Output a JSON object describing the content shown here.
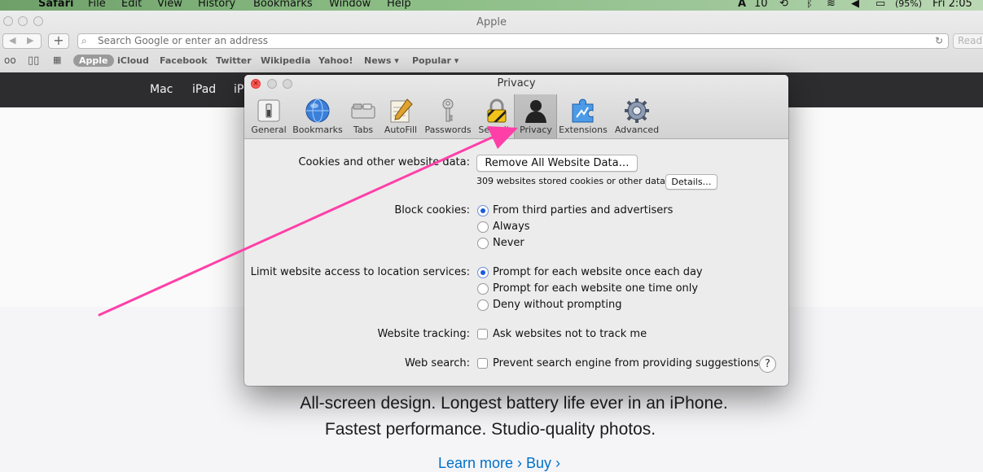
{
  "menubar": {
    "app": "Safari",
    "items": [
      "File",
      "Edit",
      "View",
      "History",
      "Bookmarks",
      "Window",
      "Help"
    ],
    "status_adobe_count": "10",
    "battery": "(95%)",
    "clock": "Fri 2:05"
  },
  "browser": {
    "window_title": "Apple",
    "address_placeholder": "Search Google or enter an address",
    "reader_label": "Read",
    "favorites": [
      "Apple",
      "iCloud",
      "Facebook",
      "Twitter",
      "Wikipedia",
      "Yahoo!",
      "News ▾",
      "Popular ▾"
    ]
  },
  "apple_site": {
    "nav": [
      "Mac",
      "iPad",
      "iP"
    ],
    "hero_line1": "All-screen design. Longest battery life ever in an iPhone.",
    "hero_line2": "Fastest performance. Studio-quality photos.",
    "links": "Learn more ›    Buy ›"
  },
  "dialog": {
    "title": "Privacy",
    "tabs": [
      {
        "label": "General",
        "icon": "general-switch-icon"
      },
      {
        "label": "Bookmarks",
        "icon": "globe-icon"
      },
      {
        "label": "Tabs",
        "icon": "tabs-icon"
      },
      {
        "label": "AutoFill",
        "icon": "autofill-pencil-icon"
      },
      {
        "label": "Passwords",
        "icon": "key-icon"
      },
      {
        "label": "Security",
        "icon": "lock-icon"
      },
      {
        "label": "Privacy",
        "icon": "person-silhouette-icon",
        "selected": true
      },
      {
        "label": "Extensions",
        "icon": "puzzle-icon"
      },
      {
        "label": "Advanced",
        "icon": "gear-icon"
      }
    ],
    "cookies_label": "Cookies and other website data:",
    "remove_all_button": "Remove All Website Data…",
    "stored_text": "309 websites stored cookies or other data",
    "details_button": "Details…",
    "block_cookies_label": "Block cookies:",
    "block_cookies_options": [
      {
        "label": "From third parties and advertisers",
        "selected": true
      },
      {
        "label": "Always",
        "selected": false
      },
      {
        "label": "Never",
        "selected": false
      }
    ],
    "location_label": "Limit website access to location services:",
    "location_options": [
      {
        "label": "Prompt for each website once each day",
        "selected": true
      },
      {
        "label": "Prompt for each website one time only",
        "selected": false
      },
      {
        "label": "Deny without prompting",
        "selected": false
      }
    ],
    "tracking_label": "Website tracking:",
    "tracking_option": "Ask websites not to track me",
    "web_search_label": "Web search:",
    "web_search_option": "Prevent search engine from providing suggestions",
    "help_label": "?"
  },
  "colors": {
    "annotation_arrow": "#ff3fa8",
    "selected_radio": "#1a5ad8"
  }
}
